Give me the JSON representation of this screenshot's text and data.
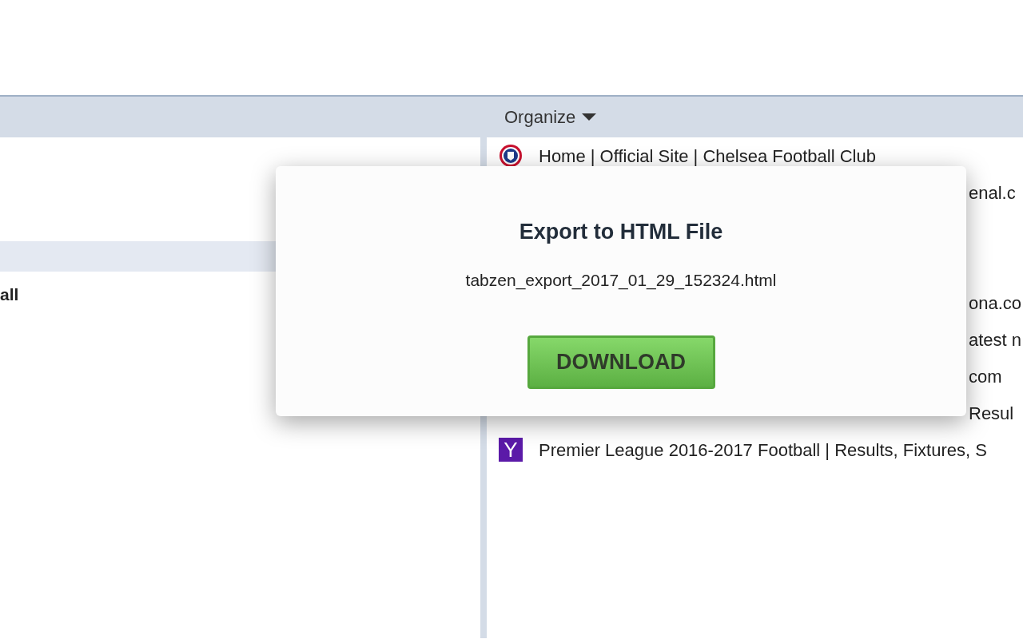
{
  "toolbar": {
    "menu_label": "Organize"
  },
  "left_panel": {
    "items": [
      {
        "selected": true
      },
      {
        "label": "all",
        "selected": false
      }
    ]
  },
  "bookmarks": [
    {
      "kind": "crest",
      "title": "Home | Official Site | Chelsea Football Club"
    },
    {
      "kind": "fragment",
      "title": "enal.c"
    },
    {
      "kind": "hidden"
    },
    {
      "kind": "hidden"
    },
    {
      "kind": "fragment",
      "title": "ona.co"
    },
    {
      "kind": "fragment",
      "title": "atest n"
    },
    {
      "kind": "fragment",
      "title": "com"
    },
    {
      "kind": "fragment",
      "title": "Resul"
    },
    {
      "kind": "letter",
      "icon_text": "Y",
      "title": "Premier League 2016-2017 Football | Results, Fixtures, S"
    }
  ],
  "dialog": {
    "title": "Export to HTML File",
    "filename": "tabzen_export_2017_01_29_152324.html",
    "button": "DOWNLOAD"
  }
}
